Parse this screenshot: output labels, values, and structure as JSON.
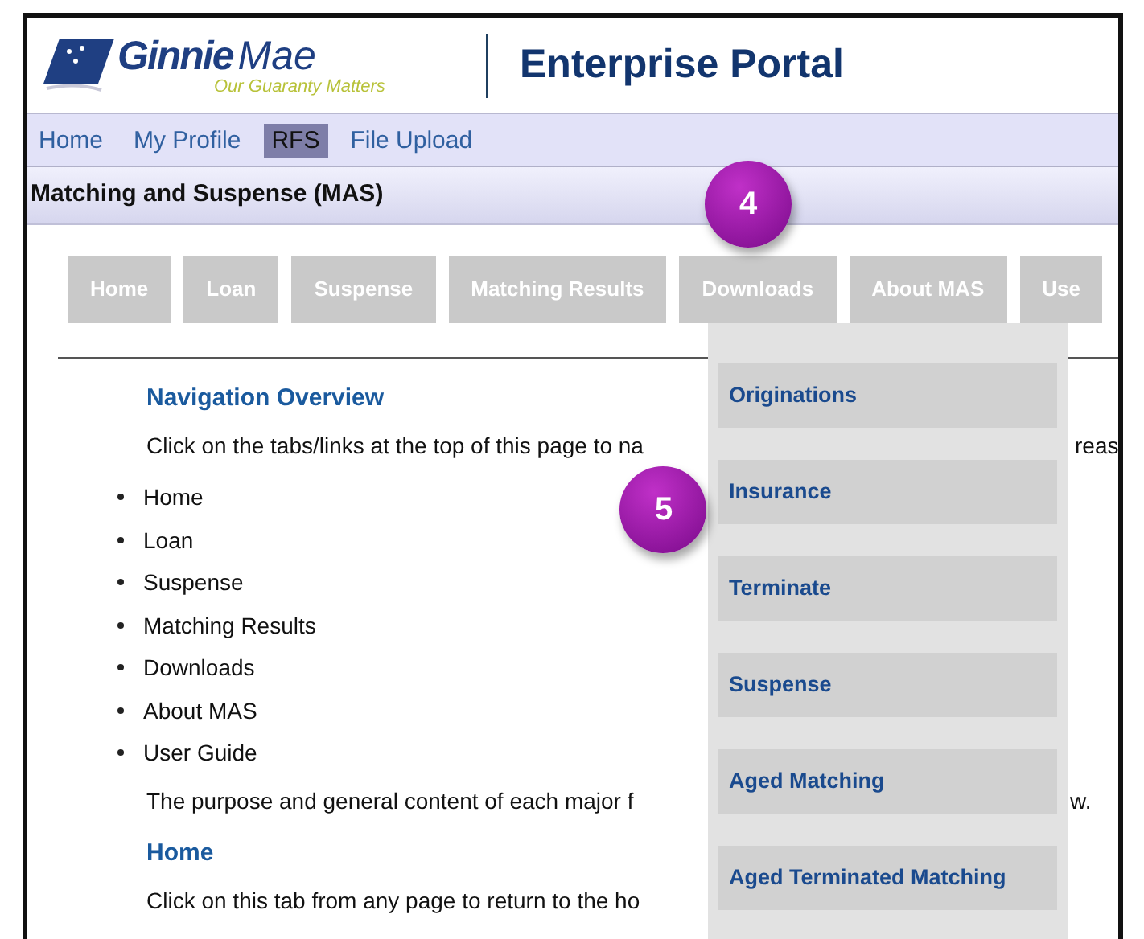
{
  "header": {
    "logo_name": "Ginnie",
    "logo_name_light": "Mae",
    "tagline": "Our Guaranty Matters",
    "title": "Enterprise Portal"
  },
  "top_nav": [
    {
      "label": "Home",
      "selected": false
    },
    {
      "label": "My Profile",
      "selected": false
    },
    {
      "label": "RFS",
      "selected": true
    },
    {
      "label": "File Upload",
      "selected": false
    }
  ],
  "section_title": "Matching and Suspense (MAS)",
  "tabs": [
    {
      "label": "Home"
    },
    {
      "label": "Loan"
    },
    {
      "label": "Suspense"
    },
    {
      "label": "Matching Results"
    },
    {
      "label": "Downloads"
    },
    {
      "label": "About MAS"
    },
    {
      "label": "Use"
    }
  ],
  "downloads_menu": [
    "Originations",
    "Insurance",
    "Terminate",
    "Suspense",
    "Aged Matching",
    "Aged Terminated Matching"
  ],
  "content": {
    "heading": "Navigation Overview",
    "intro_left": "Click on the tabs/links at the top of this page to na",
    "intro_right": "reas",
    "bullets": [
      "Home",
      "Loan",
      "Suspense",
      "Matching Results",
      "Downloads",
      "About MAS",
      "User Guide"
    ],
    "purpose_left": "The purpose and general content of each major f",
    "purpose_right": "w.",
    "home_heading": "Home",
    "home_text": "Click on this tab from any page to return to the ho"
  },
  "callouts": [
    {
      "number": "4"
    },
    {
      "number": "5"
    }
  ]
}
